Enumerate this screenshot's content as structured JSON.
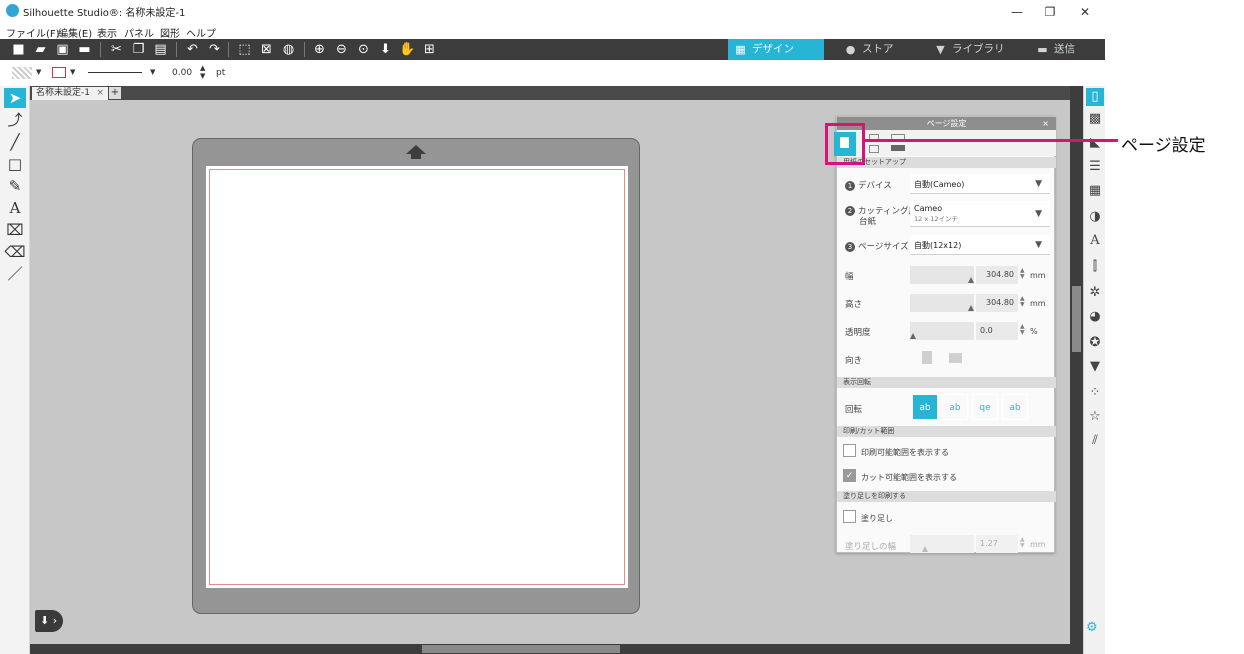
{
  "window": {
    "title": "Silhouette Studio®: 名称未設定-1",
    "minimize": "—",
    "restore": "❐",
    "close": "✕"
  },
  "menu": [
    "ファイル(F)",
    "編集(E)",
    "表示",
    "パネル",
    "図形",
    "ヘルプ"
  ],
  "topnav": {
    "design": "デザイン",
    "store": "ストア",
    "library": "ライブラリ",
    "send": "送信"
  },
  "properties": {
    "line_width": "0.00",
    "line_unit": "pt"
  },
  "document_tab": {
    "name": "名称未設定-1",
    "close": "×",
    "add": "+"
  },
  "page_settings_panel": {
    "title": "ページ設定",
    "close": "×",
    "media_section": "用紙のセットアップ",
    "device_label": "デバイス",
    "device_value": "自動(Cameo)",
    "mat_label_1": "カッティング用",
    "mat_label_2": "台紙",
    "mat_value": "Cameo",
    "mat_sub": "12 x 12インチ",
    "page_size_label": "ページサイズ",
    "page_size_value": "自動(12x12)",
    "width_label": "幅",
    "width_value": "304.80",
    "width_unit": "mm",
    "height_label": "高さ",
    "height_value": "304.80",
    "height_unit": "mm",
    "transparency_label": "透明度",
    "transparency_value": "0.0",
    "transparency_unit": "%",
    "orientation_label": "向き",
    "rotate_section": "表示回転",
    "rotate_label": "回転",
    "rotate_options": [
      "ab",
      "ab",
      "qe",
      "ab"
    ],
    "print_section": "印刷/カット範囲",
    "show_print_area": "印刷可能範囲を表示する",
    "show_print_area_checked": false,
    "show_cut_area": "カット可能範囲を表示する",
    "show_cut_area_checked": true,
    "bleed_section": "塗り足しを印刷する",
    "bleed_label": "塗り足し",
    "bleed_checked": false,
    "bleed_width_label": "塗り足しの幅",
    "bleed_width_value": "1.27",
    "bleed_width_unit": "mm"
  },
  "callout": {
    "text": "ページ設定"
  },
  "colors": {
    "accent": "#26b5d4",
    "callout": "#d6127d",
    "toolbar": "#3c3c3c",
    "canvas": "#c7c7c7"
  }
}
